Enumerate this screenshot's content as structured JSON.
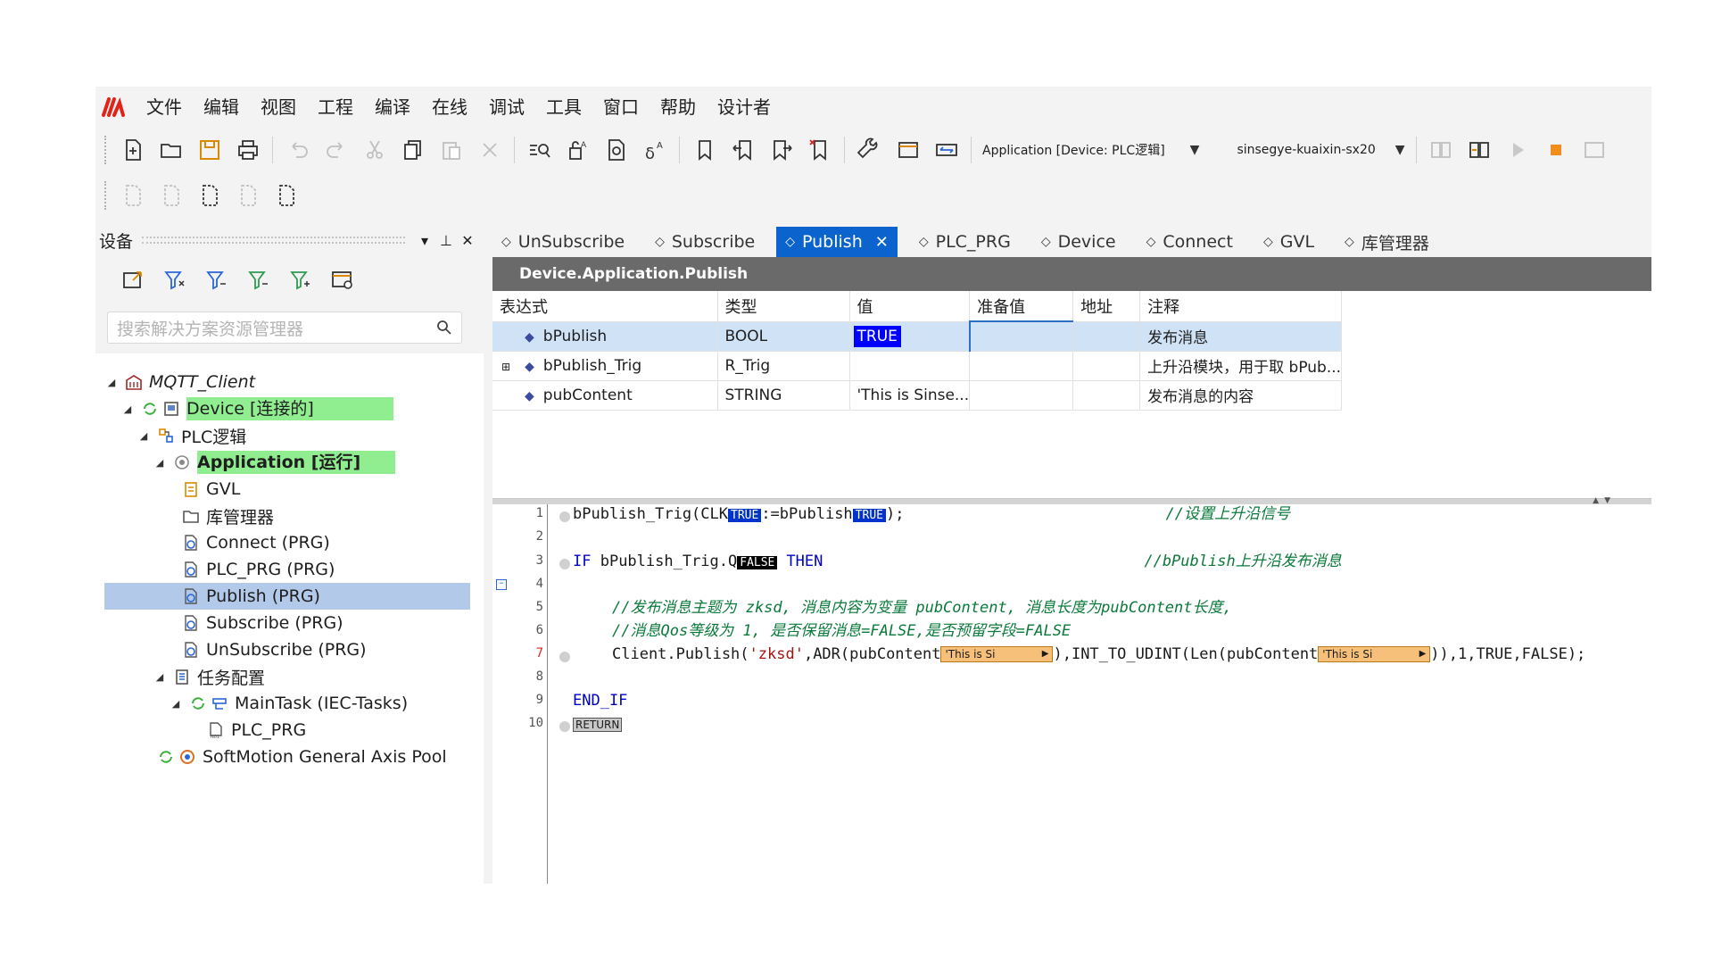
{
  "menu": [
    "文件",
    "编辑",
    "视图",
    "工程",
    "编译",
    "在线",
    "调试",
    "工具",
    "窗口",
    "帮助",
    "设计者"
  ],
  "toolbar": {
    "application_select": "Application [Device: PLC逻辑]",
    "target_select": "sinsegye-kuaixin-sx20"
  },
  "devices_panel": {
    "title": "设备",
    "search_placeholder": "搜索解决方案资源管理器",
    "tree": [
      {
        "label": "MQTT_Client",
        "italic": true
      },
      {
        "label": "Device [连接的]"
      },
      {
        "label": "PLC逻辑"
      },
      {
        "label": "Application [运行]"
      },
      {
        "label": "GVL"
      },
      {
        "label": "库管理器"
      },
      {
        "label": "Connect (PRG)"
      },
      {
        "label": "PLC_PRG (PRG)"
      },
      {
        "label": "Publish (PRG)"
      },
      {
        "label": "Subscribe (PRG)"
      },
      {
        "label": "UnSubscribe (PRG)"
      },
      {
        "label": "任务配置"
      },
      {
        "label": "MainTask (IEC-Tasks)"
      },
      {
        "label": "PLC_PRG"
      },
      {
        "label": "SoftMotion General Axis Pool"
      }
    ]
  },
  "tabs": [
    "UnSubscribe",
    "Subscribe",
    "Publish",
    "PLC_PRG",
    "Device",
    "Connect",
    "GVL",
    "库管理器"
  ],
  "active_tab": "Publish",
  "editor": {
    "title": "Device.Application.Publish",
    "columns": [
      "表达式",
      "类型",
      "值",
      "准备值",
      "地址",
      "注释"
    ],
    "rows": [
      {
        "expr": "bPublish",
        "type": "BOOL",
        "value": "TRUE",
        "prepared": "",
        "address": "",
        "comment": "发布消息"
      },
      {
        "expr": "bPublish_Trig",
        "type": "R_Trig",
        "value": "",
        "prepared": "",
        "address": "",
        "comment": "上升沿模块，用于取 bPub..."
      },
      {
        "expr": "pubContent",
        "type": "STRING",
        "value": "'This is Sinse...",
        "prepared": "",
        "address": "",
        "comment": "发布消息的内容"
      }
    ],
    "line_numbers": [
      "1",
      "2",
      "3",
      "4",
      "5",
      "6",
      "7",
      "8",
      "9",
      "10"
    ],
    "code": {
      "l1a": "bPublish_Trig(CLK",
      "l1_mon1": "TRUE",
      "l1b": ":=bPublish",
      "l1_mon2": "TRUE",
      "l1c": ");",
      "l1_comment": "//设置上升沿信号",
      "l3_if": "IF",
      "l3a": " bPublish_Trig.Q",
      "l3_mon": "FALSE",
      "l3_then": "THEN",
      "l3_comment": "//bPublish上升沿发布消息",
      "l5_comment": "//发布消息主题为 zksd, 消息内容为变量 pubContent, 消息长度为pubContent长度,",
      "l6_comment": "//消息Qos等级为 1, 是否保留消息=FALSE,是否预留字段=FALSE",
      "l7a": "Client.Publish(",
      "l7_str": "'zksd'",
      "l7b": ",ADR(pubContent",
      "l7_mon1": "'This is Si",
      "l7c": "),INT_TO_UDINT(Len(pubContent",
      "l7_mon2": "'This is Si",
      "l7d": ")),1,TRUE,FALSE);",
      "l9": "END_IF",
      "l10": "RETURN"
    }
  },
  "colors": {
    "accent": "#0b63ce",
    "running": "#90ee90",
    "selected": "#b3c9ea",
    "logo": "#e0241b"
  }
}
